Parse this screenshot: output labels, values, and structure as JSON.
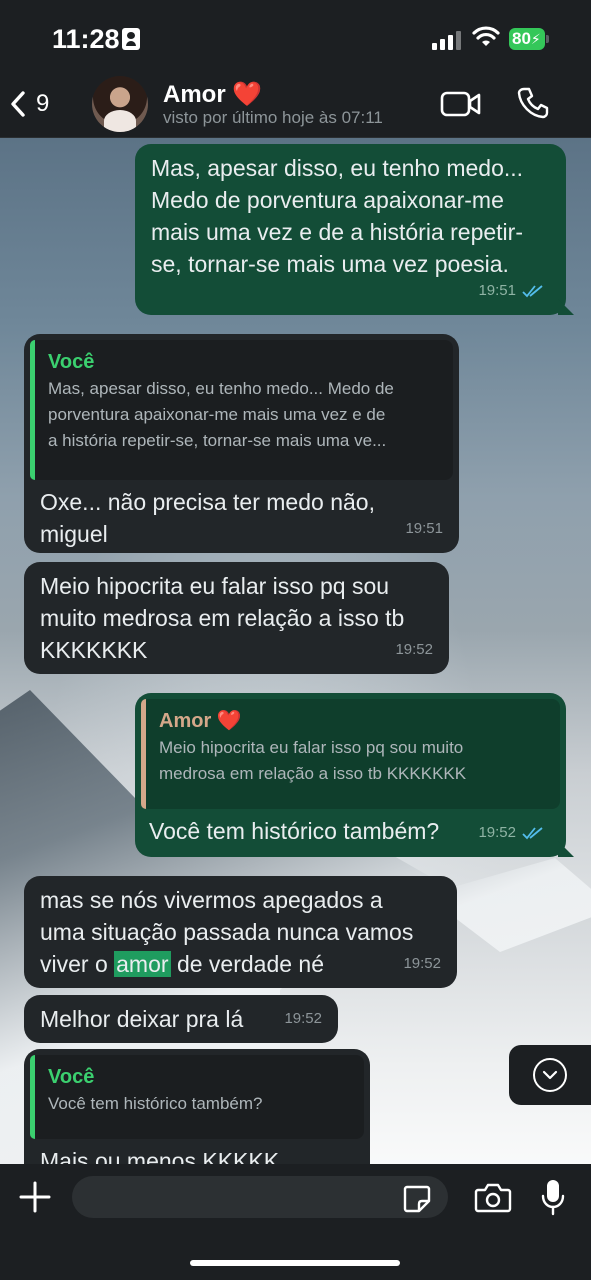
{
  "status_bar": {
    "time": "11:28",
    "battery": "80"
  },
  "header": {
    "back_count": "9",
    "contact_name": "Amor",
    "contact_emoji": "❤️",
    "contact_status": "visto por último hoje às 07:11"
  },
  "messages": [
    {
      "direction": "outgoing",
      "text_lines": [
        "Mas, apesar disso, eu tenho medo...",
        "Medo de porventura apaixonar-me",
        "mais uma vez e de a história repetir-",
        "se, tornar-se mais uma vez poesia."
      ],
      "time": "19:51",
      "status": "read"
    },
    {
      "direction": "incoming",
      "quote": {
        "author": "Você",
        "text_lines": [
          "Mas, apesar disso, eu tenho medo... Medo de",
          "porventura apaixonar-me mais uma vez e de",
          "a história repetir-se, tornar-se mais uma ve..."
        ]
      },
      "text_lines": [
        "Oxe... não precisa ter medo não,",
        "miguel"
      ],
      "time": "19:51"
    },
    {
      "direction": "incoming",
      "text_lines": [
        "Meio hipocrita eu falar isso pq sou",
        "muito medrosa em relação a isso tb",
        "KKKKKKK"
      ],
      "time": "19:52"
    },
    {
      "direction": "outgoing",
      "quote": {
        "author": "Amor",
        "author_emoji": "❤️",
        "text_lines": [
          "Meio hipocrita eu falar isso pq sou muito",
          "medrosa em relação a isso tb KKKKKKK"
        ]
      },
      "text": "Você tem histórico também?",
      "time": "19:52",
      "status": "read"
    },
    {
      "direction": "incoming",
      "line1": "mas se nós vivermos apegados a",
      "line2": "uma situação passada nunca vamos",
      "line3_before": "viver o",
      "highlight": "amor",
      "line3_after": "de verdade né",
      "time": "19:52"
    },
    {
      "direction": "incoming",
      "text": "Melhor deixar pra lá",
      "time": "19:52"
    },
    {
      "direction": "incoming",
      "quote": {
        "author": "Você",
        "text": "Você tem histórico também?"
      },
      "text": "Mais ou menos KKKKK"
    }
  ],
  "input": {
    "placeholder": ""
  },
  "colors": {
    "outgoing_bubble": "#134d37",
    "incoming_bubble": "#222629",
    "accent_green": "#3bd06f",
    "quote_tan": "#d4a88a",
    "read_ticks": "#53bdeb"
  }
}
